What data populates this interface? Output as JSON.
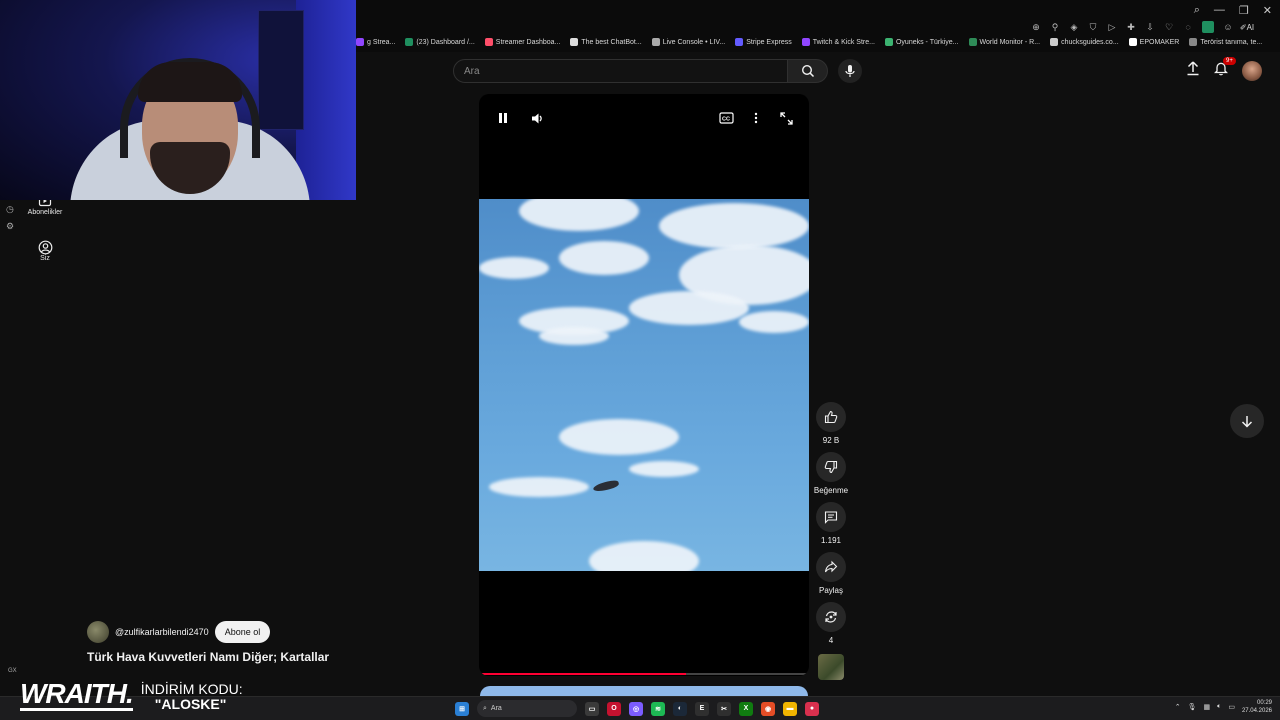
{
  "bookmarks": [
    {
      "label": "g Strea...",
      "color": "#9146ff"
    },
    {
      "label": "(23) Dashboard /...",
      "color": "#1f8f5f"
    },
    {
      "label": "Streamer Dashboa...",
      "color": "#ff4f6a"
    },
    {
      "label": "The best ChatBot...",
      "color": "#dddddd"
    },
    {
      "label": "Live Console • LIV...",
      "color": "#aaaaaa"
    },
    {
      "label": "Stripe Express",
      "color": "#635bff"
    },
    {
      "label": "Twitch & Kick Stre...",
      "color": "#9146ff"
    },
    {
      "label": "Oyuneks - Türkiye...",
      "color": "#3cb371"
    },
    {
      "label": "World Monitor - R...",
      "color": "#2e8b57"
    },
    {
      "label": "chucksguides.co...",
      "color": "#cccccc"
    },
    {
      "label": "EPOMAKER",
      "color": "#ffffff"
    },
    {
      "label": "Terörist tanıma, te...",
      "color": "#888888"
    }
  ],
  "rail": {
    "subscriptions_label": "Abonelikler",
    "you_label": "Siz"
  },
  "header": {
    "search_placeholder": "Ara",
    "notification_count": "9+"
  },
  "player": {
    "progress_fraction": 0.63
  },
  "actions": {
    "likes": "92 B",
    "dislike_label": "Beğenme",
    "comments": "1.191",
    "share_label": "Paylaş",
    "remix_count": "4"
  },
  "video": {
    "channel": "@zulfikarlarbilendi2470",
    "subscribe_label": "Abone ol",
    "title": "Türk Hava Kuvvetleri Namı Diğer; Kartallar"
  },
  "sponsor": {
    "brand": "WRAITH.",
    "line1": "İNDİRİM KODU:",
    "line2": "\"ALOSKE\""
  },
  "taskbar": {
    "search_text": "Ara",
    "time": "00:29",
    "date": "27.04.2026"
  },
  "colors": {
    "background": "#0f0f0f",
    "accent_red": "#ff0033",
    "button_bg": "#272727"
  }
}
